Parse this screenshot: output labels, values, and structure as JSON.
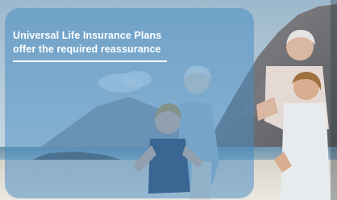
{
  "banner": {
    "line1": "Universal Life Insurance Plans",
    "line2": "offer the required reassurance"
  },
  "colors": {
    "sky": "#a9c3d6",
    "sea": "#6d93ad",
    "sand": "#d9d7cf",
    "mountain": "#6a6a6e",
    "banner_overlay": "#468cc4",
    "text": "#ffffff"
  },
  "scene": {
    "subjects": [
      "grandmother",
      "grandfather",
      "boy",
      "girl"
    ]
  }
}
